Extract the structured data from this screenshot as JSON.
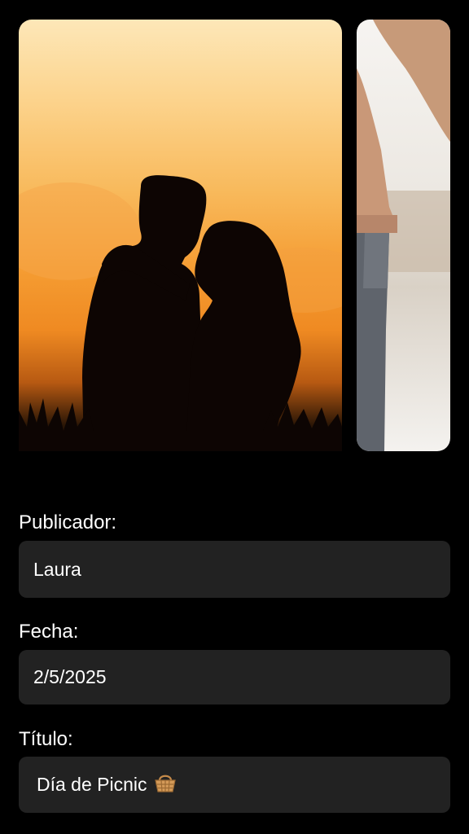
{
  "carousel": {
    "images": [
      {
        "alt": "Silhouette of couple at sunset",
        "icon": "sunset-couple-photo"
      },
      {
        "alt": "Person in knit sweater and jeans",
        "icon": "sweater-jeans-photo"
      }
    ]
  },
  "form": {
    "publisher": {
      "label": "Publicador:",
      "value": "Laura"
    },
    "date": {
      "label": "Fecha:",
      "value": "2/5/2025"
    },
    "title": {
      "label": "Título:",
      "value": "Día de Picnic",
      "icon": "basket-icon"
    }
  },
  "colors": {
    "background": "#000000",
    "field_bg": "#222222",
    "text": "#ffffff"
  }
}
